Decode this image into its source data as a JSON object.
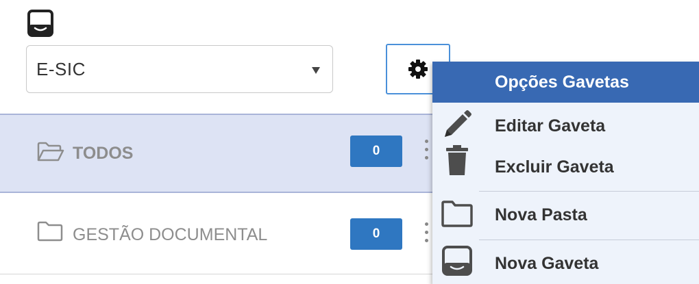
{
  "drawer_select": {
    "value": "E-SIC",
    "icon": "drawer-icon",
    "caret_icon": "caret-down-icon"
  },
  "settings_button": {
    "icon": "gear-icon"
  },
  "folders": [
    {
      "icon": "folder-open-icon",
      "label": "TODOS",
      "count": "0",
      "selected": true,
      "menu_icon": "kebab-icon"
    },
    {
      "icon": "folder-icon",
      "label": "GESTÃO DOCUMENTAL",
      "count": "0",
      "selected": false,
      "menu_icon": "kebab-icon"
    }
  ],
  "dropdown": {
    "header": "Opções Gavetas",
    "items": [
      {
        "icon": "pencil-icon",
        "label": "Editar Gaveta"
      },
      {
        "icon": "trash-icon",
        "label": "Excluir Gaveta"
      },
      {
        "icon": "folder-icon",
        "label": "Nova Pasta"
      },
      {
        "icon": "drawer-icon",
        "label": "Nova Gaveta"
      }
    ]
  },
  "colors": {
    "selected_row_bg": "#dde3f4",
    "badge_bg": "#2f77c1",
    "menu_header_bg": "#3869b3",
    "menu_bg": "#eef3fb",
    "button_border": "#4a90d9"
  }
}
